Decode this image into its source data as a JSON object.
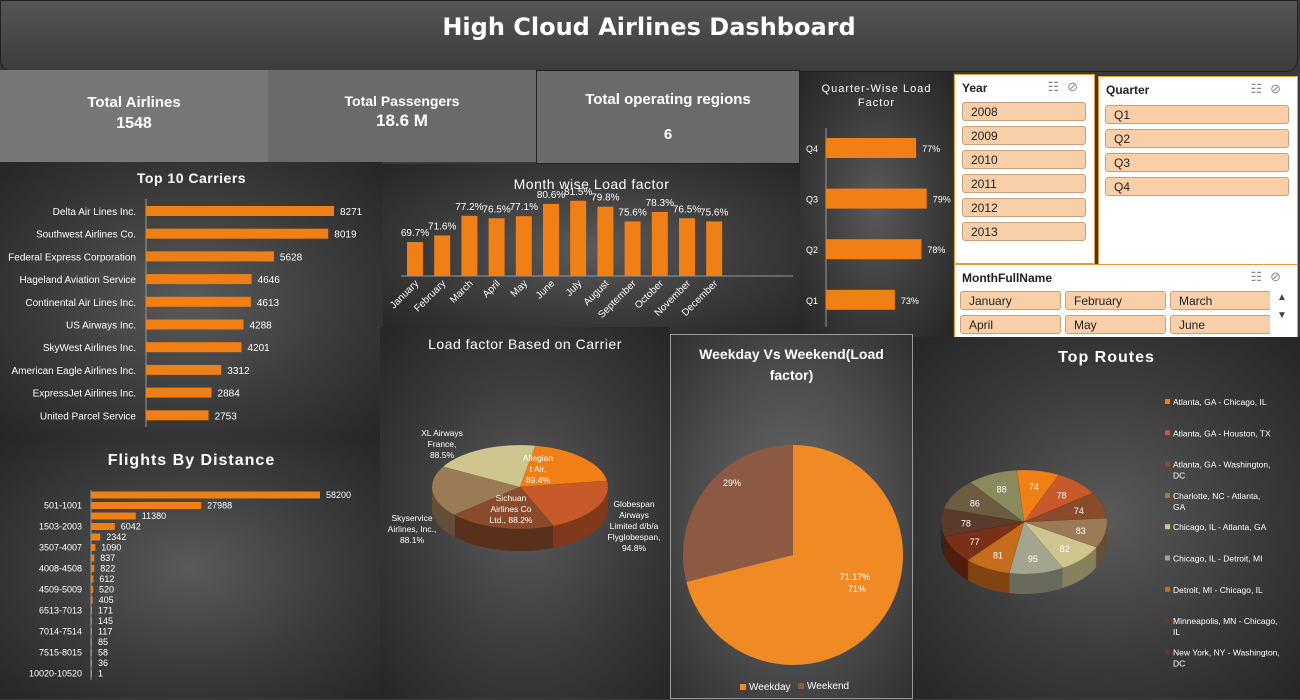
{
  "header": {
    "title": "High Cloud Airlines Dashboard"
  },
  "kpis": [
    {
      "label": "Total Airlines",
      "value": "1548"
    },
    {
      "label": "Total Passengers",
      "value": "18.6 M"
    },
    {
      "label": "Total operating regions",
      "value": "6"
    }
  ],
  "colors": {
    "accent": "#f07f16",
    "slicer_btn": "#f8cfa8",
    "slicer_border": "#e39b3b"
  },
  "slicers": {
    "year": {
      "title": "Year",
      "items": [
        "2008",
        "2009",
        "2010",
        "2011",
        "2012",
        "2013"
      ]
    },
    "quarter": {
      "title": "Quarter",
      "items": [
        "Q1",
        "Q2",
        "Q3",
        "Q4"
      ]
    },
    "month": {
      "title": "MonthFullName",
      "items": [
        "January",
        "February",
        "March",
        "April",
        "May",
        "June"
      ]
    },
    "icons": [
      "multi-select-icon",
      "clear-filter-icon"
    ]
  },
  "chart_data": [
    {
      "id": "top_carriers",
      "type": "bar",
      "orientation": "horizontal",
      "title": "Top 10 Carriers",
      "categories": [
        "Delta Air Lines Inc.",
        "Southwest Airlines Co.",
        "Federal Express Corporation",
        "Hageland Aviation Service",
        "Continental Air Lines Inc.",
        "US Airways Inc.",
        "SkyWest Airlines Inc.",
        "American Eagle Airlines Inc.",
        "ExpressJet Airlines Inc.",
        "United Parcel Service"
      ],
      "values": [
        8271,
        8019,
        5628,
        4646,
        4613,
        4288,
        4201,
        3312,
        2884,
        2753
      ],
      "labels": [
        "8271",
        "8019",
        "5628",
        "4646",
        "4613",
        "4288",
        "4201",
        "3312",
        "2884",
        "2753"
      ]
    },
    {
      "id": "month_load",
      "type": "bar",
      "title": "Month wise Load factor",
      "categories": [
        "January",
        "February",
        "March",
        "April",
        "May",
        "June",
        "July",
        "August",
        "September",
        "October",
        "November",
        "December"
      ],
      "values": [
        69.7,
        71.6,
        77.2,
        76.5,
        77.1,
        80.6,
        81.5,
        79.8,
        75.6,
        78.3,
        76.5,
        75.6
      ],
      "labels": [
        "69.7%",
        "71.6%",
        "77.2%",
        "76.5%",
        "77.1%",
        "80.6%",
        "81.5%",
        "79.8%",
        "75.6%",
        "78.3%",
        "76.5%",
        "75.6%"
      ]
    },
    {
      "id": "quarter_load",
      "type": "bar",
      "orientation": "horizontal",
      "title": "Quarter-Wise Load Factor",
      "categories": [
        "Q4",
        "Q3",
        "Q2",
        "Q1"
      ],
      "values": [
        77,
        79,
        78,
        73
      ],
      "labels": [
        "77%",
        "79%",
        "78%",
        "73%"
      ]
    },
    {
      "id": "flights_distance",
      "type": "bar",
      "orientation": "horizontal",
      "title": "Flights By Distance",
      "categories": [
        "",
        "501-1001",
        "",
        "1503-2003",
        "",
        "3507-4007",
        "",
        "4008-4508",
        "",
        "4509-5009",
        "",
        "6513-7013",
        "",
        "7014-7514",
        "",
        "7515-8015",
        "",
        "10020-10520"
      ],
      "values": [
        58200,
        27988,
        11380,
        6042,
        2342,
        1090,
        837,
        822,
        612,
        520,
        405,
        171,
        145,
        117,
        85,
        58,
        36,
        1
      ],
      "labels": [
        "58200",
        "27988",
        "11380",
        "6042",
        "2342",
        "1090",
        "837",
        "822",
        "612",
        "520",
        "405",
        "171",
        "145",
        "117",
        "85",
        "58",
        "36",
        "1"
      ]
    },
    {
      "id": "carrier_load",
      "type": "pie",
      "title": "Load factor Based on Carrier",
      "slices": [
        {
          "label": "Allegiant Air, 89.4%",
          "value": 89.4,
          "color": "#f07f16"
        },
        {
          "label": "Globespan Airways Limited d/b/a Flyglobespan, 94.8%",
          "value": 94.8,
          "color": "#c8592a"
        },
        {
          "label": "Sichuan Airlines Co Ltd., 88.2%",
          "value": 88.2,
          "color": "#8a4b2c"
        },
        {
          "label": "Skyservice Airlines, Inc., 88.1%",
          "value": 88.1,
          "color": "#9b7b55"
        },
        {
          "label": "XL Airways France, 88.5%",
          "value": 88.5,
          "color": "#cfc58e"
        }
      ]
    },
    {
      "id": "weekday_weekend",
      "type": "pie",
      "title": "Weekday Vs Weekend(Load factor)",
      "slices": [
        {
          "name": "Weekday",
          "value": 71.17,
          "label": "71.17%",
          "label2": "71%",
          "color": "#f08a24"
        },
        {
          "name": "Weekend",
          "value": 29,
          "label": "29%",
          "color": "#8c5a43"
        }
      ],
      "legend": [
        "Weekday",
        "Weekend"
      ]
    },
    {
      "id": "top_routes",
      "type": "pie",
      "title": "Top Routes",
      "slices": [
        {
          "name": "Atlanta, GA - Chicago, IL",
          "value": 74,
          "color": "#f07f16"
        },
        {
          "name": "Atlanta, GA - Houston, TX",
          "value": 78,
          "color": "#c8592a"
        },
        {
          "name": "Atlanta, GA - Washington, DC",
          "value": 74,
          "color": "#8a4b2c"
        },
        {
          "name": "Charlotte, NC - Atlanta, GA",
          "value": 83,
          "color": "#9b7b55"
        },
        {
          "name": "Chicago, IL - Atlanta, GA",
          "value": 82,
          "color": "#cfc58e"
        },
        {
          "name": "Chicago, IL - Detroit, MI",
          "value": 95,
          "color": "#a4a48f"
        },
        {
          "name": "Detroit, MI - Chicago, IL",
          "value": 81,
          "color": "#c76b1c"
        },
        {
          "name": "Minneapolis, MN - Chicago, IL",
          "value": 77,
          "color": "#7a2f18"
        },
        {
          "name": "New York, NY - Washington, DC",
          "value": 78,
          "color": "#5a3a2a"
        },
        {
          "name": "",
          "value": 86,
          "color": "#6c5c40"
        },
        {
          "name": "",
          "value": 88,
          "color": "#8a8a5c"
        }
      ]
    }
  ]
}
